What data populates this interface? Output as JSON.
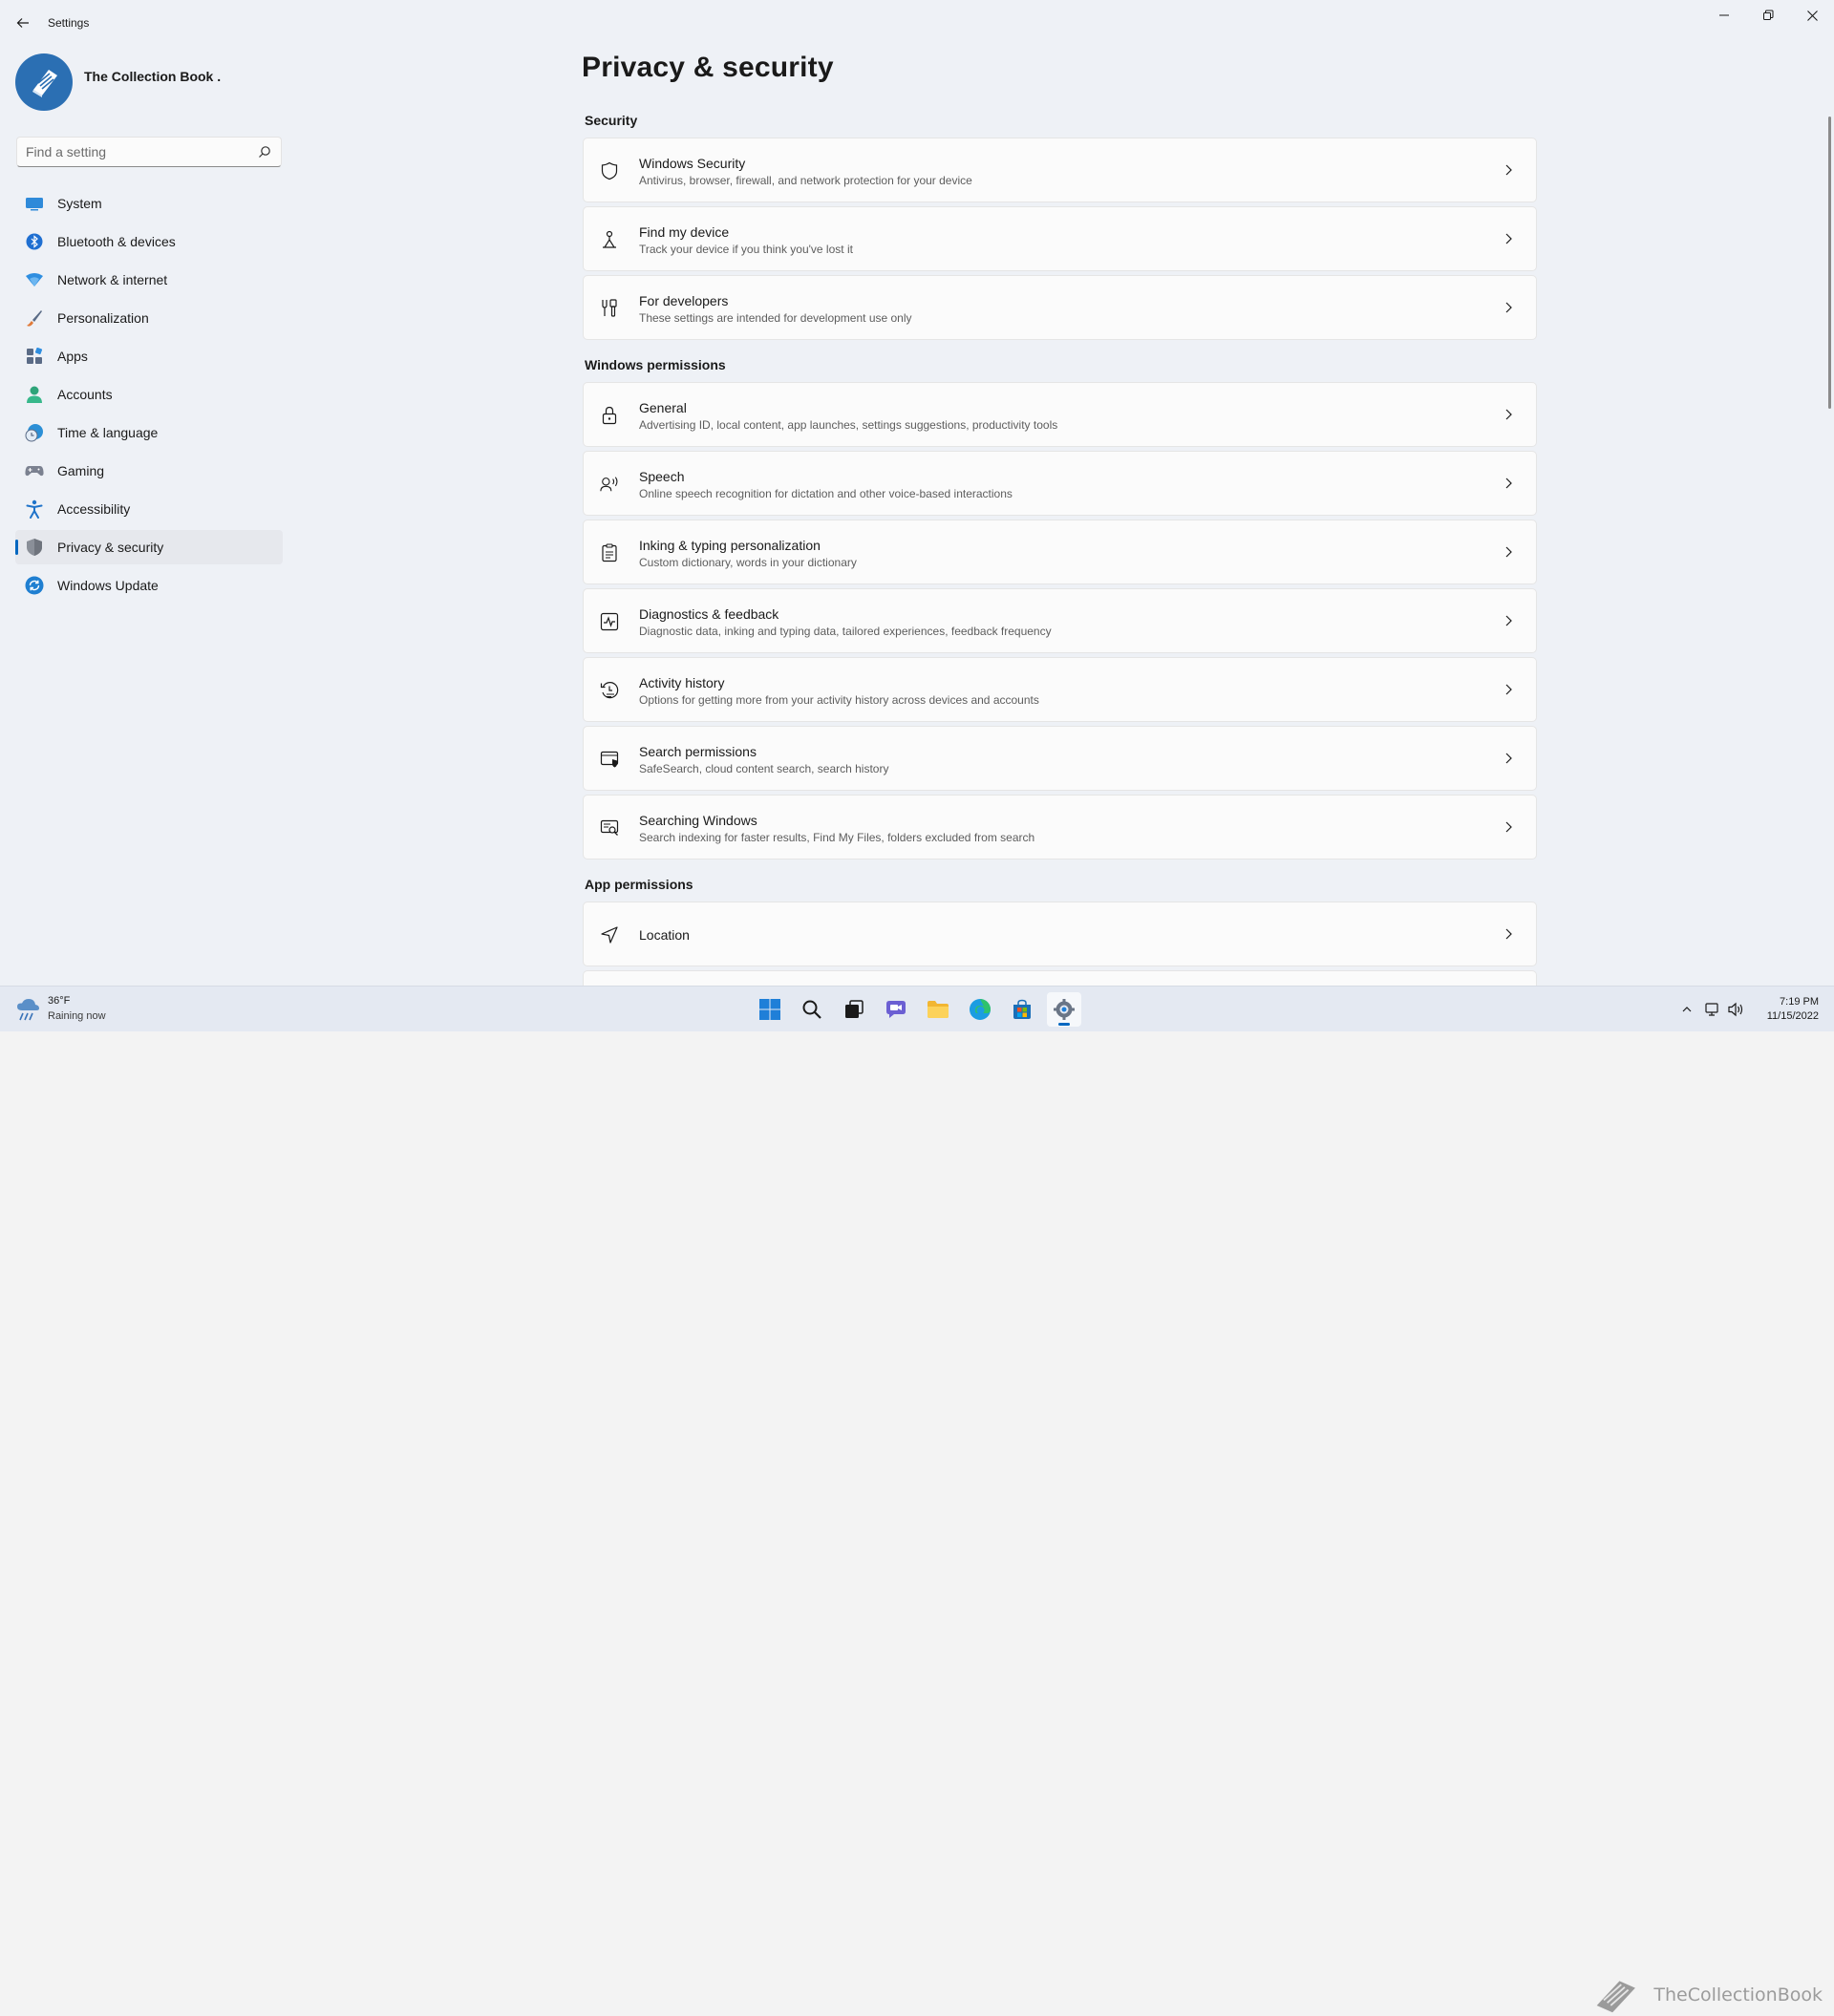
{
  "window": {
    "app_title": "Settings"
  },
  "profile": {
    "name": "The Collection Book ."
  },
  "search": {
    "placeholder": "Find a setting"
  },
  "nav": {
    "items": [
      {
        "label": "System",
        "icon": "system-icon",
        "color": "#2f8ad9"
      },
      {
        "label": "Bluetooth & devices",
        "icon": "bluetooth-icon",
        "color": "#1f6fd1"
      },
      {
        "label": "Network & internet",
        "icon": "wifi-icon",
        "color": "#2e8ee0"
      },
      {
        "label": "Personalization",
        "icon": "brush-icon",
        "color": "#e07b3a"
      },
      {
        "label": "Apps",
        "icon": "apps-icon",
        "color": "#5a6b86"
      },
      {
        "label": "Accounts",
        "icon": "accounts-icon",
        "color": "#2ea47a"
      },
      {
        "label": "Time & language",
        "icon": "time-language-icon",
        "color": "#2b8fd6"
      },
      {
        "label": "Gaming",
        "icon": "gaming-icon",
        "color": "#7b8190"
      },
      {
        "label": "Accessibility",
        "icon": "accessibility-icon",
        "color": "#1f73c9"
      },
      {
        "label": "Privacy & security",
        "icon": "shield-icon",
        "color": "#7a7f88",
        "active": true
      },
      {
        "label": "Windows Update",
        "icon": "update-icon",
        "color": "#1f7fd1"
      }
    ]
  },
  "main": {
    "title": "Privacy & security",
    "sections": {
      "security": "Security",
      "windows_permissions": "Windows permissions",
      "app_permissions": "App permissions"
    },
    "cards": [
      {
        "title": "Windows Security",
        "subtitle": "Antivirus, browser, firewall, and network protection for your device",
        "icon": "shield-outline-icon"
      },
      {
        "title": "Find my device",
        "subtitle": "Track your device if you think you've lost it",
        "icon": "find-device-icon"
      },
      {
        "title": "For developers",
        "subtitle": "These settings are intended for development use only",
        "icon": "developer-tools-icon"
      },
      {
        "title": "General",
        "subtitle": "Advertising ID, local content, app launches, settings suggestions, productivity tools",
        "icon": "lock-icon"
      },
      {
        "title": "Speech",
        "subtitle": "Online speech recognition for dictation and other voice-based interactions",
        "icon": "speech-icon"
      },
      {
        "title": "Inking & typing personalization",
        "subtitle": "Custom dictionary, words in your dictionary",
        "icon": "inking-icon"
      },
      {
        "title": "Diagnostics & feedback",
        "subtitle": "Diagnostic data, inking and typing data, tailored experiences, feedback frequency",
        "icon": "diagnostics-icon"
      },
      {
        "title": "Activity history",
        "subtitle": "Options for getting more from your activity history across devices and accounts",
        "icon": "history-icon"
      },
      {
        "title": "Search permissions",
        "subtitle": "SafeSearch, cloud content search, search history",
        "icon": "search-permissions-icon"
      },
      {
        "title": "Searching Windows",
        "subtitle": "Search indexing for faster results, Find My Files, folders excluded from search",
        "icon": "searching-windows-icon"
      },
      {
        "title": "Location",
        "subtitle": "",
        "icon": "location-icon"
      }
    ]
  },
  "taskbar": {
    "weather_temp": "36°F",
    "weather_condition": "Raining now",
    "time": "7:19 PM",
    "date": "11/15/2022",
    "watermark": "TheCollectionBook",
    "accent": "#0067c0"
  }
}
